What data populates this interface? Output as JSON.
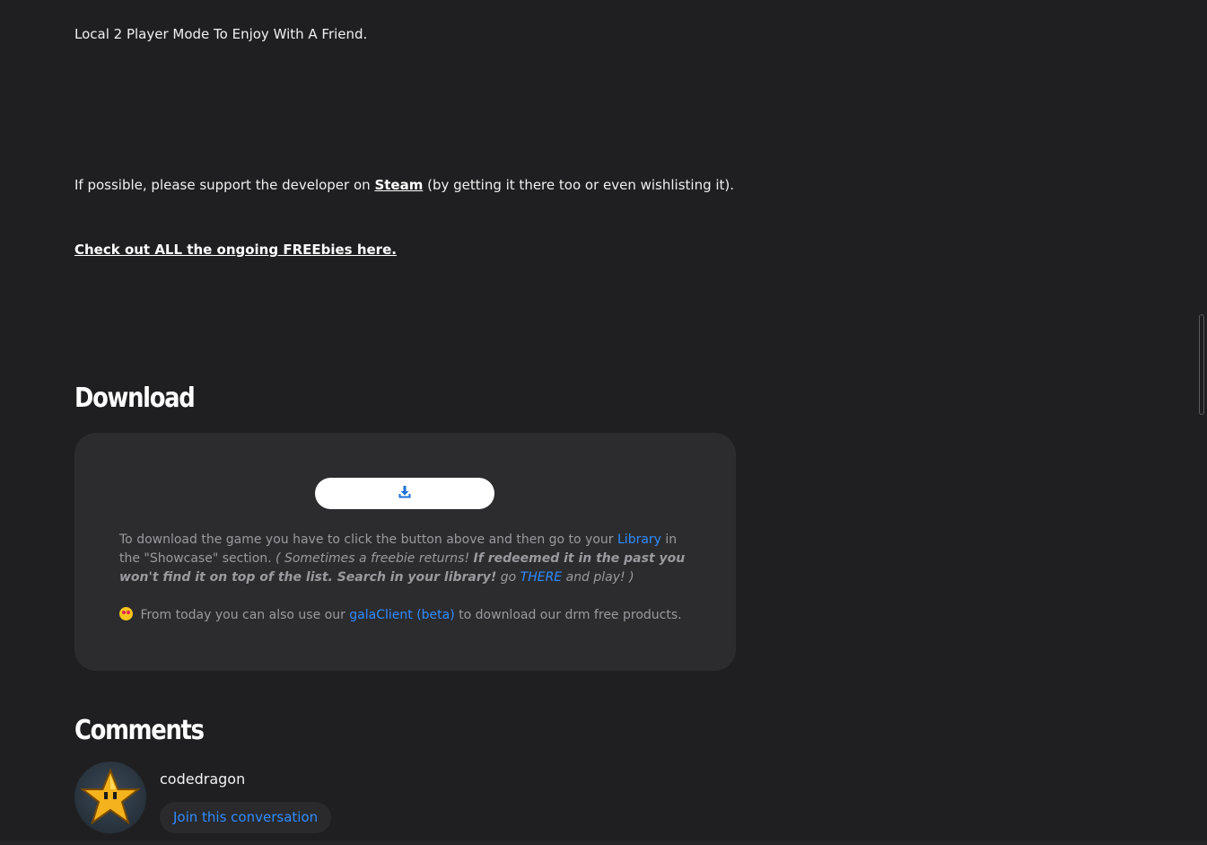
{
  "description": {
    "line_local": "Local 2 Player Mode To Enjoy With A Friend.",
    "support_prefix": "If possible, please support the developer on",
    "support_link": "Steam",
    "support_suffix": "(by getting it there too or even wishlisting it).",
    "freebies_link": "Check out ALL the ongoing FREEbies here."
  },
  "download": {
    "heading": "Download",
    "button_icon": "download-icon",
    "p1_prefix": "To download the game you have to click the button above and then go to your",
    "p1_library_link": "Library",
    "p1_mid": "in the \"Showcase\" section.",
    "p1_italic": "( Sometimes a freebie returns!",
    "p1_bold_italic": "If redeemed it in the past you won't find it on top of the list. Search in your library!",
    "p1_go": "go",
    "p1_there_link": "THERE",
    "p1_end": "and play! )",
    "p2_emoji": "star-struck-emoji",
    "p2_prefix": "From today you can also use our",
    "p2_link": "galaClient (beta)",
    "p2_suffix": "to download our drm free products."
  },
  "comments": {
    "heading": "Comments",
    "username": "codedragon",
    "join_label": "Join this conversation",
    "avatar_icon": "star-avatar-icon"
  },
  "colors": {
    "background": "#1f1f21",
    "card": "#2c2c2f",
    "link_blue": "#2f8cff",
    "muted_text": "#9a9a9f"
  }
}
